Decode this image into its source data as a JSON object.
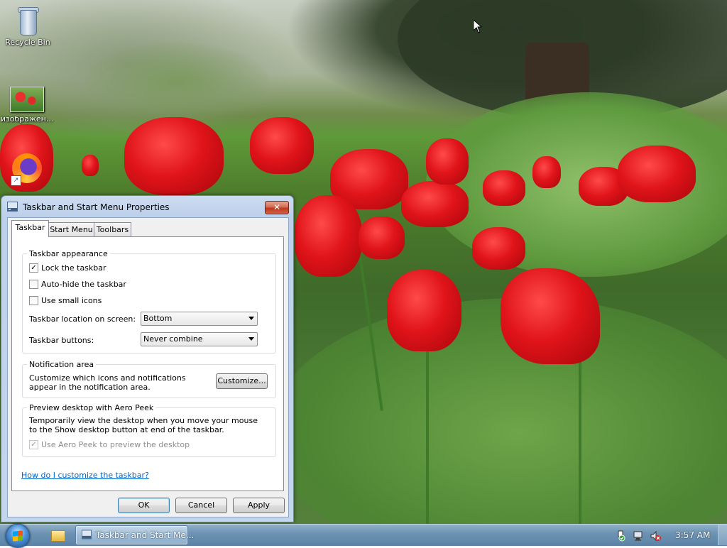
{
  "desktop": {
    "icons": [
      {
        "label": "Recycle Bin",
        "icon": "recycle-bin-icon"
      },
      {
        "label": "изображен...",
        "icon": "image-file-icon"
      },
      {
        "label": "",
        "icon": "firefox-icon"
      }
    ]
  },
  "dialog": {
    "title": "Taskbar and Start Menu Properties",
    "close_label": "✕",
    "tabs": [
      {
        "label": "Taskbar",
        "active": true
      },
      {
        "label": "Start Menu",
        "active": false
      },
      {
        "label": "Toolbars",
        "active": false
      }
    ],
    "appearance": {
      "title": "Taskbar appearance",
      "lock_taskbar": {
        "label": "Lock the taskbar",
        "checked": true
      },
      "auto_hide": {
        "label": "Auto-hide the taskbar",
        "checked": false
      },
      "small_icons": {
        "label": "Use small icons",
        "checked": false
      },
      "location": {
        "label": "Taskbar location on screen:",
        "value": "Bottom"
      },
      "buttons": {
        "label": "Taskbar buttons:",
        "value": "Never combine"
      }
    },
    "notification": {
      "title": "Notification area",
      "text": "Customize which icons and notifications appear in the notification area.",
      "customize_label": "Customize..."
    },
    "aero_peek": {
      "title": "Preview desktop with Aero Peek",
      "text": "Temporarily view the desktop when you move your mouse to the Show desktop button at end of the taskbar.",
      "use_peek": {
        "label": "Use Aero Peek to preview the desktop",
        "checked": true,
        "disabled": true
      }
    },
    "help_link": "How do I customize the taskbar?",
    "buttons": {
      "ok": "OK",
      "cancel": "Cancel",
      "apply": "Apply"
    }
  },
  "taskbar": {
    "active_window_label": "Taskbar and Start Me...",
    "clock": "3:57 AM",
    "tray_icons": [
      "action-center-icon",
      "network-icon",
      "volume-muted-icon"
    ]
  },
  "colors": {
    "link": "#0066cc",
    "close_button": "#c0381b",
    "taskbar": "#6e93b3"
  }
}
